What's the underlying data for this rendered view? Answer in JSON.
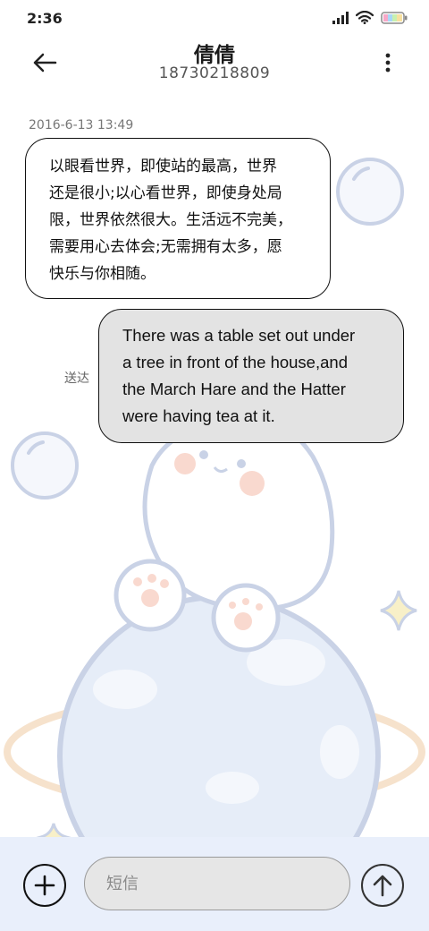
{
  "status_bar": {
    "time": "2:36",
    "icons": [
      "signal-icon",
      "wifi-icon",
      "battery-icon"
    ]
  },
  "header": {
    "contact_name": "倩倩",
    "contact_number": "18730218809",
    "back_icon": "arrow-left-icon",
    "more_icon": "more-vertical-icon"
  },
  "conversation": {
    "timestamp": "2016-6-13 13:49",
    "messages": [
      {
        "direction": "incoming",
        "lines": [
          "以眼看世界，即使站的最高，世界",
          "还是很小;以心看世界，即使身处局",
          "限，世界依然很大。生活远不完美，",
          "需要用心去体会;无需拥有太多，愿",
          "快乐与你相随。"
        ]
      },
      {
        "direction": "outgoing",
        "status": "送达",
        "lines": [
          "There was a table set out under",
          "a tree in front of the house,and",
          "the March Hare and the Hatter",
          "were having tea at it."
        ]
      }
    ]
  },
  "composer": {
    "add_icon": "plus-icon",
    "placeholder": "短信",
    "value": "",
    "send_icon": "arrow-up-icon"
  },
  "colors": {
    "composer_bg": "#e9effb",
    "outgoing_bubble": "#e3e3e3",
    "incoming_bubble": "#ffffff",
    "wallpaper_line": "#c9d2e6"
  }
}
